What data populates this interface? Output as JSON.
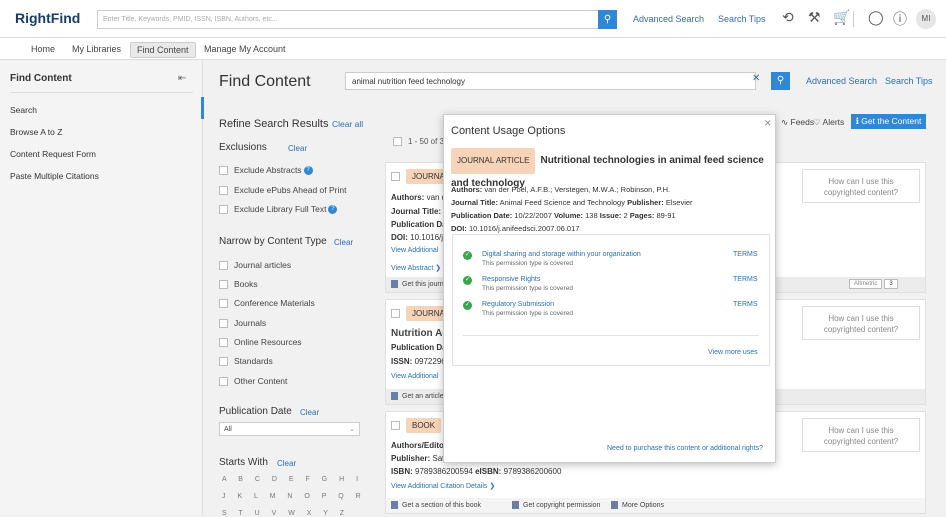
{
  "app": {
    "logo": "RightFind"
  },
  "topbar": {
    "search_placeholder": "Enter Title, Keywords, PMID, ISSN, ISBN, Authors, etc...",
    "advanced_search": "Advanced Search",
    "search_tips": "Search Tips",
    "avatar_initials": "MI",
    "icons": [
      "history-icon",
      "tools-icon",
      "cart-icon",
      "chat-icon",
      "help-icon"
    ]
  },
  "nav": {
    "items": [
      "Home",
      "My Libraries",
      "Find Content",
      "Manage My Account"
    ],
    "active": "Find Content"
  },
  "sidebar": {
    "title": "Find Content",
    "items": [
      "Search",
      "Browse A to Z",
      "Content Request Form",
      "Paste Multiple Citations"
    ],
    "active": "Search"
  },
  "main": {
    "title": "Find Content",
    "search_value": "animal nutrition feed technology",
    "advanced_search": "Advanced Search",
    "search_tips": "Search Tips"
  },
  "refine": {
    "title": "Refine Search Results",
    "clear_all": "Clear all",
    "exclusions": {
      "title": "Exclusions",
      "clear": "Clear",
      "items": [
        "Exclude Abstracts",
        "Exclude ePubs Ahead of Print",
        "Exclude Library Full Text"
      ]
    },
    "content_type": {
      "title": "Narrow by Content Type",
      "clear": "Clear",
      "items": [
        "Journal articles",
        "Books",
        "Conference Materials",
        "Journals",
        "Online Resources",
        "Standards",
        "Other Content"
      ]
    },
    "pub_date": {
      "title": "Publication Date",
      "clear": "Clear",
      "selected": "All"
    },
    "starts_with": {
      "title": "Starts With",
      "clear": "Clear",
      "rows": [
        "A B C D E F G H I",
        "J K L M N O P Q R",
        "S T U V W X Y Z"
      ]
    }
  },
  "results": {
    "count_text": "1 - 50 of 3",
    "feeds": "Feeds",
    "alerts": "Alerts",
    "get_content": "Get the Content",
    "copyright_q": "How can I use this copyrighted content?",
    "cards": [
      {
        "badge": "JOURNA",
        "authors_label": "Authors:",
        "authors_val": "van d",
        "journal_label": "Journal Title:",
        "journal_val": "A",
        "pubdate_label": "Publication Da",
        "doi_label": "DOI:",
        "doi_val": "10.1016/j",
        "link1": "View Additional",
        "link2": "View Abstract",
        "foot": "Get this journ",
        "altmetric": "Altmetric",
        "altmetric_score": "3"
      },
      {
        "badge": "JOURNA",
        "title": "Nutrition As",
        "pubdate_label": "Publication Da",
        "issn_label": "ISSN:",
        "issn_val": "09722960",
        "link1": "View Additional",
        "foot": "Get an article"
      },
      {
        "badge": "BOOK",
        "authors_label": "Authors/Edito",
        "publisher_label": "Publisher:",
        "publisher_val": "Sati",
        "isbn_label": "ISBN:",
        "isbn_val": "9789386200594",
        "eisbn_label": "eISBN:",
        "eisbn_val": "9789386200600",
        "link1": "View Additional Citation Details",
        "foot_items": [
          "Get a section of this book",
          "Get copyright permission",
          "More Options"
        ]
      }
    ]
  },
  "modal": {
    "title": "Content Usage Options",
    "badge": "JOURNAL ARTICLE",
    "article_title": "Nutritional technologies in animal feed science and technology",
    "authors_label": "Authors:",
    "authors": "van der Poel, A.F.B.; Verstegen, M.W.A.; Robinson, P.H.",
    "journal_label": "Journal Title:",
    "journal": "Animal Feed Science and Technology",
    "publisher_label": "Publisher:",
    "publisher": "Elsevier",
    "pubdate_label": "Publication Date:",
    "pubdate": "10/22/2007",
    "volume_label": "Volume:",
    "volume": "138",
    "issue_label": "Issue:",
    "issue": "2",
    "pages_label": "Pages:",
    "pages": "89-91",
    "doi_label": "DOI:",
    "doi": "10.1016/j.anifeedsci.2007.06.017",
    "permissions": [
      {
        "name": "Digital sharing and storage within your organization",
        "sub": "This permission type is covered",
        "terms": "TERMS"
      },
      {
        "name": "Responsive Rights",
        "sub": "This permission type is covered",
        "terms": "TERMS"
      },
      {
        "name": "Regulatory Submission",
        "sub": "This permission type is covered",
        "terms": "TERMS"
      }
    ],
    "view_more": "View more uses",
    "purchase_link": "Need to purchase this content or additional rights?"
  }
}
